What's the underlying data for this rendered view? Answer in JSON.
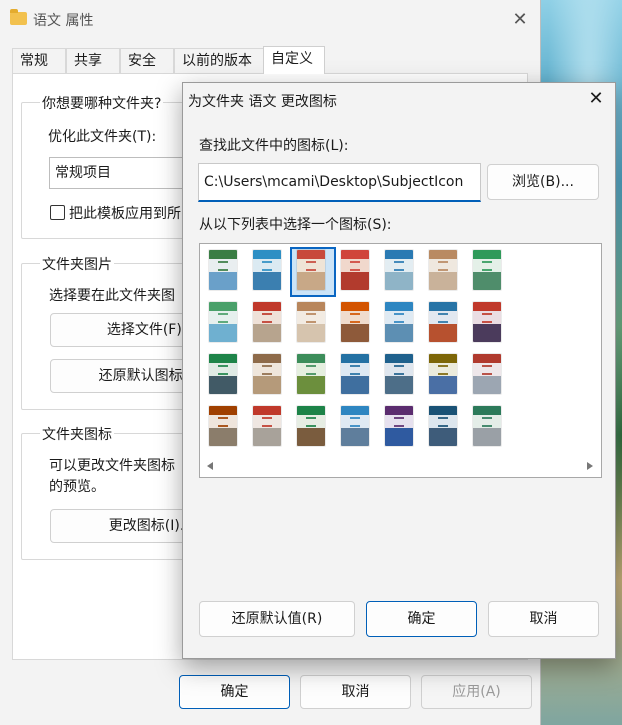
{
  "back_window": {
    "title": "语文 属性",
    "close_glyph": "✕",
    "tabs": [
      "常规",
      "共享",
      "安全",
      "以前的版本",
      "自定义"
    ],
    "active_tab": "自定义",
    "group_folder_type": {
      "legend": "你想要哪种文件夹?",
      "optimize_label": "优化此文件夹(T):",
      "optimize_value": "常规项目",
      "apply_template_label": "把此模板应用到所",
      "apply_template_checked": false
    },
    "group_folder_pictures": {
      "legend": "文件夹图片",
      "description": "选择要在此文件夹图",
      "choose_file_label": "选择文件(F)...",
      "restore_default_icon_label": "还原默认图标(R)"
    },
    "group_folder_icons": {
      "legend": "文件夹图标",
      "description_line1": "可以更改文件夹图标",
      "description_line2": "的预览。",
      "change_icon_label": "更改图标(I)..."
    },
    "footer": {
      "ok_label": "确定",
      "cancel_label": "取消",
      "apply_label": "应用(A)"
    }
  },
  "dialog": {
    "title": "为文件夹 语文 更改图标",
    "close_glyph": "✕",
    "find_label": "查找此文件中的图标(L):",
    "path_value": "C:\\Users\\mcami\\Desktop\\SubjectIcon",
    "browse_label": "浏览(B)...",
    "select_label": "从以下列表中选择一个图标(S):",
    "selected_icon_index": 2,
    "icons": [
      {
        "band": "#3a7d44",
        "scene": "#6aa0c9",
        "bg": "#e9eef0"
      },
      {
        "band": "#2d8fc4",
        "scene": "#3b7fb0",
        "bg": "#dbeaf2"
      },
      {
        "band": "#c84a3c",
        "scene": "#c8a887",
        "bg": "#efe4d6"
      },
      {
        "band": "#d0453a",
        "scene": "#b23b2d",
        "bg": "#f0d8cc"
      },
      {
        "band": "#2a7ab3",
        "scene": "#8fb4c7",
        "bg": "#e3edf2"
      },
      {
        "band": "#b98a62",
        "scene": "#c9b29a",
        "bg": "#efe8df"
      },
      {
        "band": "#2f9a5a",
        "scene": "#4f8d6b",
        "bg": "#e4f0e8"
      },
      {
        "band": "#4aa06a",
        "scene": "#6fb0d0",
        "bg": "#e6f0ee"
      },
      {
        "band": "#c0392b",
        "scene": "#b7a48e",
        "bg": "#efe1d8"
      },
      {
        "band": "#b8865c",
        "scene": "#d6c4ae",
        "bg": "#f2ebe2"
      },
      {
        "band": "#d35400",
        "scene": "#8e5a3a",
        "bg": "#f0dccd"
      },
      {
        "band": "#2e86c1",
        "scene": "#5d8fb3",
        "bg": "#dfeaf3"
      },
      {
        "band": "#2874a6",
        "scene": "#b7512f",
        "bg": "#e2e8f0"
      },
      {
        "band": "#c0392b",
        "scene": "#4b3b5c",
        "bg": "#eadde3"
      },
      {
        "band": "#1e8449",
        "scene": "#415a66",
        "bg": "#e0ebe5"
      },
      {
        "band": "#8e6b4a",
        "scene": "#b59a7a",
        "bg": "#efe6dc"
      },
      {
        "band": "#3c8d5a",
        "scene": "#6c8f3d",
        "bg": "#e5efdf"
      },
      {
        "band": "#2471a3",
        "scene": "#3f6f9f",
        "bg": "#dde8f2"
      },
      {
        "band": "#1f618d",
        "scene": "#4d6e88",
        "bg": "#dfe6ee"
      },
      {
        "band": "#7d6608",
        "scene": "#4a6fa5",
        "bg": "#ecebdc"
      },
      {
        "band": "#b03a2e",
        "scene": "#9ca6b2",
        "bg": "#eee7ea"
      },
      {
        "band": "#a04000",
        "scene": "#8b7d6b",
        "bg": "#efe5dc"
      },
      {
        "band": "#c0392b",
        "scene": "#a8a29a",
        "bg": "#efe7e2"
      },
      {
        "band": "#1d8348",
        "scene": "#7a5c3e",
        "bg": "#e6ede3"
      },
      {
        "band": "#2e86c1",
        "scene": "#5f7e9c",
        "bg": "#e0eaf3"
      },
      {
        "band": "#5b2c6f",
        "scene": "#2f5aa0",
        "bg": "#e6e0ee"
      },
      {
        "band": "#1a5276",
        "scene": "#3e5c7a",
        "bg": "#dde6ee"
      },
      {
        "band": "#2c7a5a",
        "scene": "#9aa0a6",
        "bg": "#e4ede8"
      }
    ],
    "restore_default_label": "还原默认值(R)",
    "ok_label": "确定",
    "cancel_label": "取消"
  },
  "colors": {
    "accent": "#005fb8",
    "selection_fill": "#cce4f7",
    "selection_border": "#0a66c2",
    "folder_icon": "#f2c14e"
  }
}
